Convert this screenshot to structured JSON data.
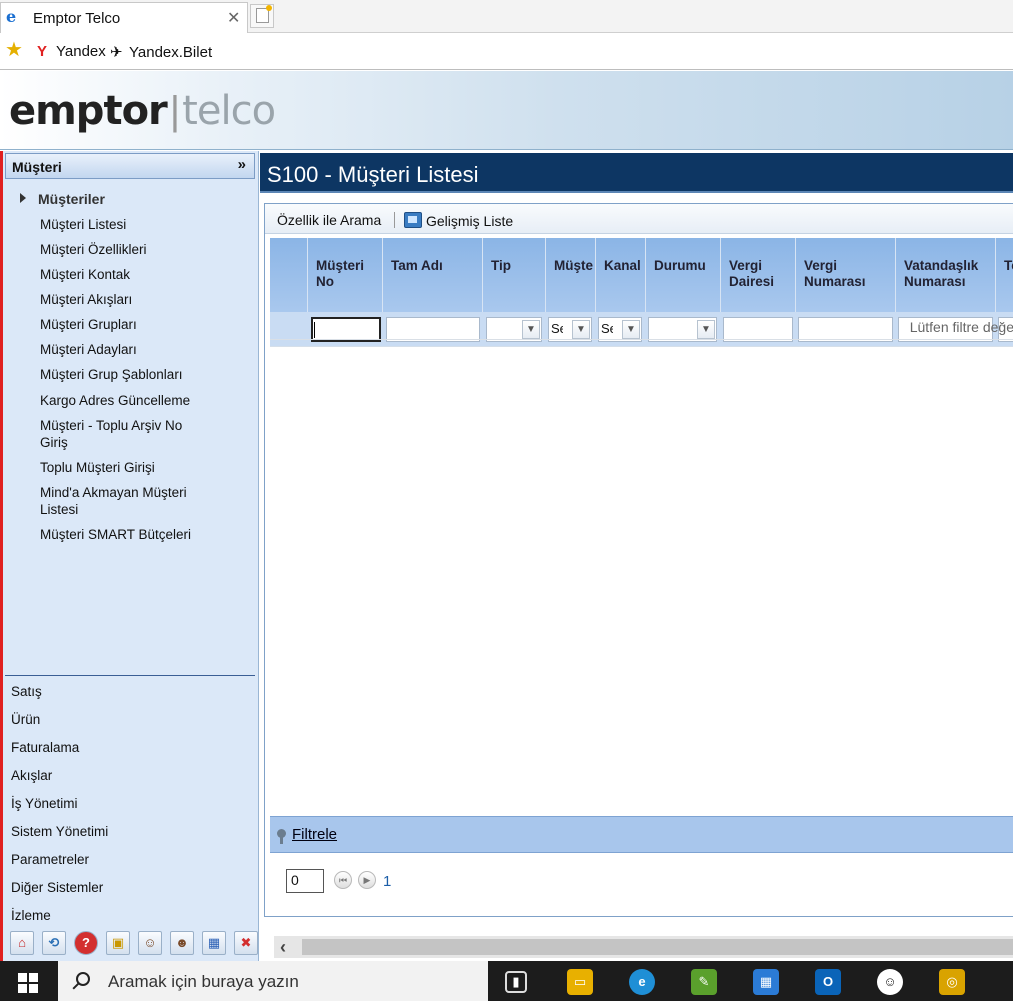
{
  "browser": {
    "tab_title": "Emptor Telco",
    "favorites": [
      {
        "label": "Yandex",
        "icon": "yandex-icon",
        "color": "#e02020"
      },
      {
        "label": "Yandex.Bilet",
        "icon": "plane-icon",
        "color": "#222222"
      }
    ]
  },
  "logo": {
    "brand": "emptor",
    "separator": "|",
    "product": "telco"
  },
  "sidebar": {
    "header": "Müşteri",
    "group": "Müşteriler",
    "items": [
      "Müşteri Listesi",
      "Müşteri Özellikleri",
      "Müşteri Kontak",
      "Müşteri Akışları",
      "Müşteri Grupları",
      "Müşteri Adayları",
      "Müşteri Grup Şablonları",
      "Kargo Adres Güncelleme",
      "Müşteri - Toplu Arşiv No Giriş",
      "Toplu Müşteri Girişi",
      "Mind'a Akmayan Müşteri Listesi",
      "Müşteri SMART Bütçeleri"
    ],
    "sections": [
      "Satış",
      "Ürün",
      "Faturalama",
      "Akışlar",
      "İş Yönetimi",
      "Sistem Yönetimi",
      "Parametreler",
      "Diğer Sistemler",
      "İzleme"
    ],
    "tools": [
      "home-icon",
      "refresh-icon",
      "help-icon",
      "lock-icon",
      "users-icon",
      "user-switch-icon",
      "windows-icon",
      "close-icon"
    ]
  },
  "main": {
    "title": "S100 - Müşteri Listesi",
    "toolbar": {
      "search_by_property": "Özellik ile Arama",
      "advanced_list": "Gelişmiş Liste"
    },
    "columns": [
      {
        "label": "",
        "key": "select"
      },
      {
        "label": "Müşteri No"
      },
      {
        "label": "Tam Adı"
      },
      {
        "label": "Tip"
      },
      {
        "label": "Müşte"
      },
      {
        "label": "Kanal"
      },
      {
        "label": "Durumu"
      },
      {
        "label": "Vergi Dairesi"
      },
      {
        "label": "Vergi Numarası"
      },
      {
        "label": "Vatandaşlık Numarası"
      },
      {
        "label": "Te"
      }
    ],
    "filters": {
      "customer_segment_value": "Se",
      "channel_value": "Se"
    },
    "hint": "Lütfen filtre değe",
    "filter_link": "Filtrele",
    "pager": {
      "page_input": "0",
      "page_number": "1"
    }
  },
  "taskbar": {
    "search_placeholder": "Aramak için buraya yazın",
    "apps": [
      {
        "icon": "task-view-icon",
        "color": "#1c1c1c"
      },
      {
        "icon": "file-explorer-icon",
        "color": "#e8b000"
      },
      {
        "icon": "edge-icon",
        "color": "#1f8fd6"
      },
      {
        "icon": "notepad-icon",
        "color": "#5aa02c"
      },
      {
        "icon": "store-icon",
        "color": "#2b7bd6"
      },
      {
        "icon": "outlook-icon",
        "color": "#0a64b8"
      },
      {
        "icon": "app-icon",
        "color": "#ffffff"
      },
      {
        "icon": "database-tool-icon",
        "color": "#d9a300"
      }
    ]
  }
}
